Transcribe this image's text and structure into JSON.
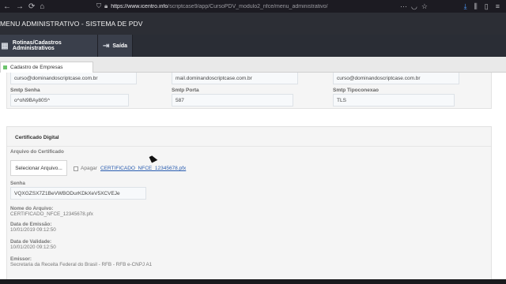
{
  "browser": {
    "url_host": "https://www.icentro.info",
    "url_path": "/scriptcase9/app/CursoPDV_modulo2_nfce/menu_administrativo/",
    "icons": [
      "back-icon",
      "forward-icon",
      "reload-icon",
      "home-icon",
      "shield-icon",
      "lock-icon",
      "more-icon",
      "pocket-icon",
      "star-icon",
      "download-icon",
      "library-icon",
      "sidebar-icon",
      "menu-icon"
    ]
  },
  "header": {
    "title": "MENU ADMINISTRATIVO - SISTEMA DE PDV"
  },
  "menu": {
    "items": [
      {
        "label": "Rotinas/Cadastros Administrativos",
        "icon": "admin-icon"
      },
      {
        "label": "Saída",
        "icon": "exit-icon"
      }
    ]
  },
  "tabs": [
    {
      "label": "Cadastro de Empresas"
    }
  ],
  "smtp": {
    "row1": [
      "curso@dominandoscriptcase.com.br",
      "mail.dominandoscriptcase.com.br",
      "curso@dominandoscriptcase.com.br"
    ],
    "labels": [
      "Smtp Senha",
      "Smtp Porta",
      "Smtp Tipoconexao"
    ],
    "values": [
      "o^oN9BAy80S^",
      "587",
      "TLS"
    ]
  },
  "certificado": {
    "section_title": "Certificado Digital",
    "arquivo_label": "Arquivo do Certificado",
    "select_button": "Selecionar Arquivo...",
    "apagar_label": "Apagar",
    "file_link": "CERTIFICADO_NFCE_12345678.pfx",
    "senha_label": "Senha",
    "senha_value": "VQXGZSX7Z1BeVWBODurKDkXeV5XCVEJe",
    "nome_label": "Nome do Arquivo:",
    "nome_value": "CERTIFICADO_NFCE_12345678.pfx",
    "emissao_label": "Data de Emissão:",
    "emissao_value": "10/01/2019 09:12:50",
    "validade_label": "Data de Validade:",
    "validade_value": "10/01/2020 09:12:50",
    "emissor_label": "Emissor:",
    "emissor_value": "Secretaria da Receita Federal do Brasil - RFB - RFB e-CNPJ A1"
  },
  "colors": {
    "chrome_bg": "#1c1b22",
    "header_bg": "#2c2e35",
    "link": "#2a5db0",
    "tab_mark": "#6cc36c"
  }
}
